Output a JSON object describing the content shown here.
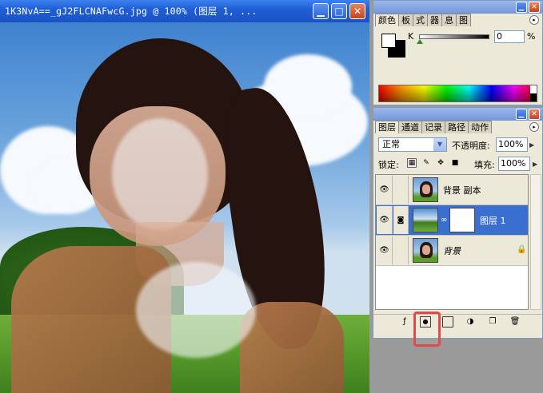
{
  "document": {
    "title": "1K3NvA==_gJ2FLCNAFwcG.jpg @ 100% (图层 1, ...",
    "minimize_label": "▁",
    "maximize_label": "□",
    "close_label": "✕"
  },
  "color_panel": {
    "tabs": [
      "颜色",
      "板",
      "式",
      "器",
      "息",
      "图"
    ],
    "channel_label": "K",
    "channel_value": "0",
    "channel_unit": "%",
    "slider_fraction": 0.0
  },
  "layers_panel": {
    "tabs": [
      "图层",
      "通道",
      "记录",
      "路径",
      "动作"
    ],
    "blend_mode": "正常",
    "opacity_label": "不透明度:",
    "opacity_value": "100%",
    "lock_label": "锁定:",
    "fill_label": "填充:",
    "fill_value": "100%",
    "layers": [
      {
        "name": "背景 副本",
        "selected": false
      },
      {
        "name": "图层 1",
        "selected": true
      },
      {
        "name": "背景",
        "selected": false
      }
    ]
  },
  "icons": {
    "eye": "👁",
    "link": "∞",
    "chain": "⛓",
    "lock": "🔒",
    "panel_menu": "▸"
  },
  "colors": {
    "title_blue": "#1f5fd6",
    "panel_bg": "#ece9d8",
    "selected_layer": "#3b6fcf",
    "highlight_red": "#e14a4a"
  }
}
